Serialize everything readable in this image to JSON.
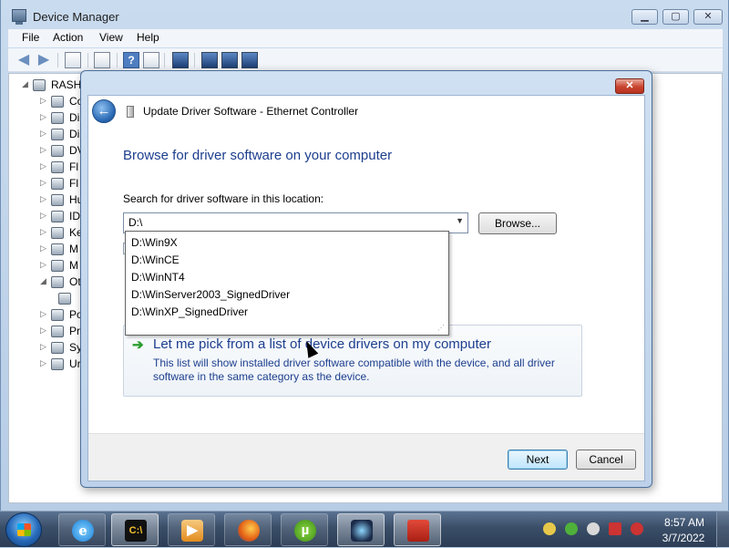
{
  "device_manager": {
    "title": "Device Manager",
    "menu": [
      "File",
      "Action",
      "View",
      "Help"
    ],
    "tree": {
      "root": "RASH",
      "items": [
        "Co",
        "Di",
        "Di",
        "DV",
        "Fl",
        "Fl",
        "Hu",
        "ID",
        "Ke",
        "M",
        "M",
        "Ot",
        "",
        "Po",
        "Pr",
        "Sy",
        "Ur"
      ]
    }
  },
  "dialog": {
    "title": "Update Driver Software - Ethernet Controller",
    "heading": "Browse for driver software on your computer",
    "search_label": "Search for driver software in this location:",
    "path_value": "D:\\",
    "browse_label": "Browse...",
    "dropdown_options": [
      "D:\\Win9X",
      "D:\\WinCE",
      "D:\\WinNT4",
      "D:\\WinServer2003_SignedDriver",
      "D:\\WinXP_SignedDriver"
    ],
    "pick_title": "Let me pick from a list of device drivers on my computer",
    "pick_description": "This list will show installed driver software compatible with the device, and all driver software in the same category as the device.",
    "next_label": "Next",
    "cancel_label": "Cancel"
  },
  "taskbar": {
    "time": "8:57 AM",
    "date": "3/7/2022",
    "apps": [
      "internet-explorer",
      "command-prompt",
      "media-player",
      "firefox",
      "utorrent",
      "app-icon",
      "toolbox"
    ]
  },
  "colors": {
    "link_blue": "#1c3e8e",
    "close_red": "#c9442f",
    "window_frame": "#bdd2ea"
  }
}
